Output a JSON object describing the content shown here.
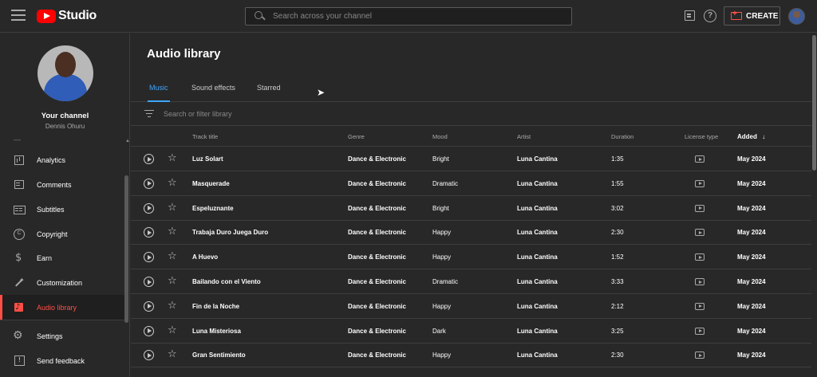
{
  "app": {
    "logo_text": "Studio",
    "brand_color": "#ff0000",
    "accent_color": "#3ea6ff"
  },
  "header": {
    "search_placeholder": "Search across your channel",
    "create_label": "CREATE",
    "help_label": "?"
  },
  "channel": {
    "title": "Your channel",
    "name": "Dennis Ohuru"
  },
  "sidebar": {
    "items": [
      {
        "label": "Analytics",
        "icon": "analytics-icon"
      },
      {
        "label": "Comments",
        "icon": "comments-icon"
      },
      {
        "label": "Subtitles",
        "icon": "subtitles-icon"
      },
      {
        "label": "Copyright",
        "icon": "copyright-icon"
      },
      {
        "label": "Earn",
        "icon": "dollar-icon"
      },
      {
        "label": "Customization",
        "icon": "magic-wand-icon"
      },
      {
        "label": "Audio library",
        "icon": "audio-library-icon",
        "active": true
      }
    ],
    "bottom": [
      {
        "label": "Settings",
        "icon": "gear-icon"
      },
      {
        "label": "Send feedback",
        "icon": "feedback-icon"
      }
    ]
  },
  "main": {
    "title": "Audio library",
    "tabs": [
      {
        "label": "Music",
        "active": true
      },
      {
        "label": "Sound effects"
      },
      {
        "label": "Starred"
      }
    ],
    "filter_placeholder": "Search or filter library",
    "columns": [
      "Track title",
      "Genre",
      "Mood",
      "Artist",
      "Duration",
      "License type",
      "Added"
    ],
    "sort_column": "Added",
    "sort_indicator": "↓",
    "tracks": [
      {
        "title": "Luz Solart",
        "genre": "Dance & Electronic",
        "mood": "Bright",
        "artist": "Luna Cantina",
        "duration": "1:35",
        "added": "May 2024"
      },
      {
        "title": "Masquerade",
        "genre": "Dance & Electronic",
        "mood": "Dramatic",
        "artist": "Luna Cantina",
        "duration": "1:55",
        "added": "May 2024"
      },
      {
        "title": "Espeluznante",
        "genre": "Dance & Electronic",
        "mood": "Bright",
        "artist": "Luna Cantina",
        "duration": "3:02",
        "added": "May 2024"
      },
      {
        "title": "Trabaja Duro Juega Duro",
        "genre": "Dance & Electronic",
        "mood": "Happy",
        "artist": "Luna Cantina",
        "duration": "2:30",
        "added": "May 2024"
      },
      {
        "title": "A Huevo",
        "genre": "Dance & Electronic",
        "mood": "Happy",
        "artist": "Luna Cantina",
        "duration": "1:52",
        "added": "May 2024"
      },
      {
        "title": "Bailando con el Viento",
        "genre": "Dance & Electronic",
        "mood": "Dramatic",
        "artist": "Luna Cantina",
        "duration": "3:33",
        "added": "May 2024"
      },
      {
        "title": "Fin de la Noche",
        "genre": "Dance & Electronic",
        "mood": "Happy",
        "artist": "Luna Cantina",
        "duration": "2:12",
        "added": "May 2024"
      },
      {
        "title": "Luna Misteriosa",
        "genre": "Dance & Electronic",
        "mood": "Dark",
        "artist": "Luna Cantina",
        "duration": "3:25",
        "added": "May 2024"
      },
      {
        "title": "Gran Sentimiento",
        "genre": "Dance & Electronic",
        "mood": "Happy",
        "artist": "Luna Cantina",
        "duration": "2:30",
        "added": "May 2024"
      }
    ]
  }
}
